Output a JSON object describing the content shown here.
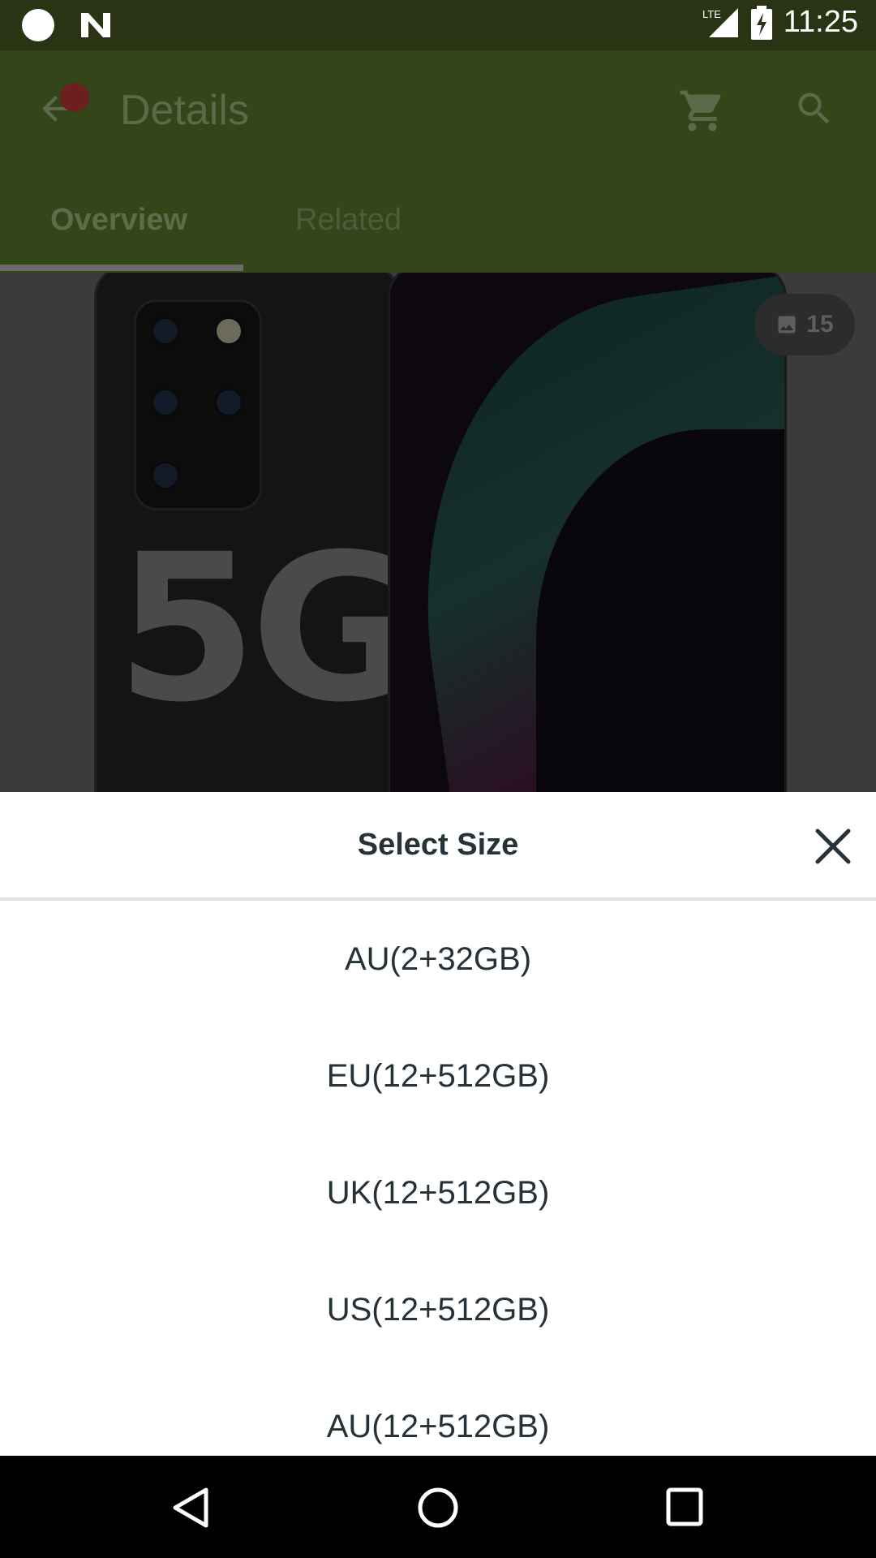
{
  "status_bar": {
    "time": "11:25",
    "network": "LTE"
  },
  "app_bar": {
    "title": "Details",
    "icons": [
      "back-arrow-icon",
      "notification-dot",
      "cart-icon",
      "search-icon"
    ]
  },
  "tabs": [
    {
      "label": "Overview",
      "selected": true
    },
    {
      "label": "Related",
      "selected": false
    }
  ],
  "hero": {
    "image_text": "5G",
    "gallery_count": "15"
  },
  "sheet": {
    "title": "Select Size",
    "options": [
      "AU(2+32GB)",
      "EU(12+512GB)",
      "UK(12+512GB)",
      "US(12+512GB)",
      "AU(12+512GB)"
    ]
  },
  "colors": {
    "app_bar_dimmed": "#334619",
    "status_bar_dimmed": "#2a3414",
    "sheet_bg": "#ffffff",
    "sheet_text": "#263238"
  }
}
